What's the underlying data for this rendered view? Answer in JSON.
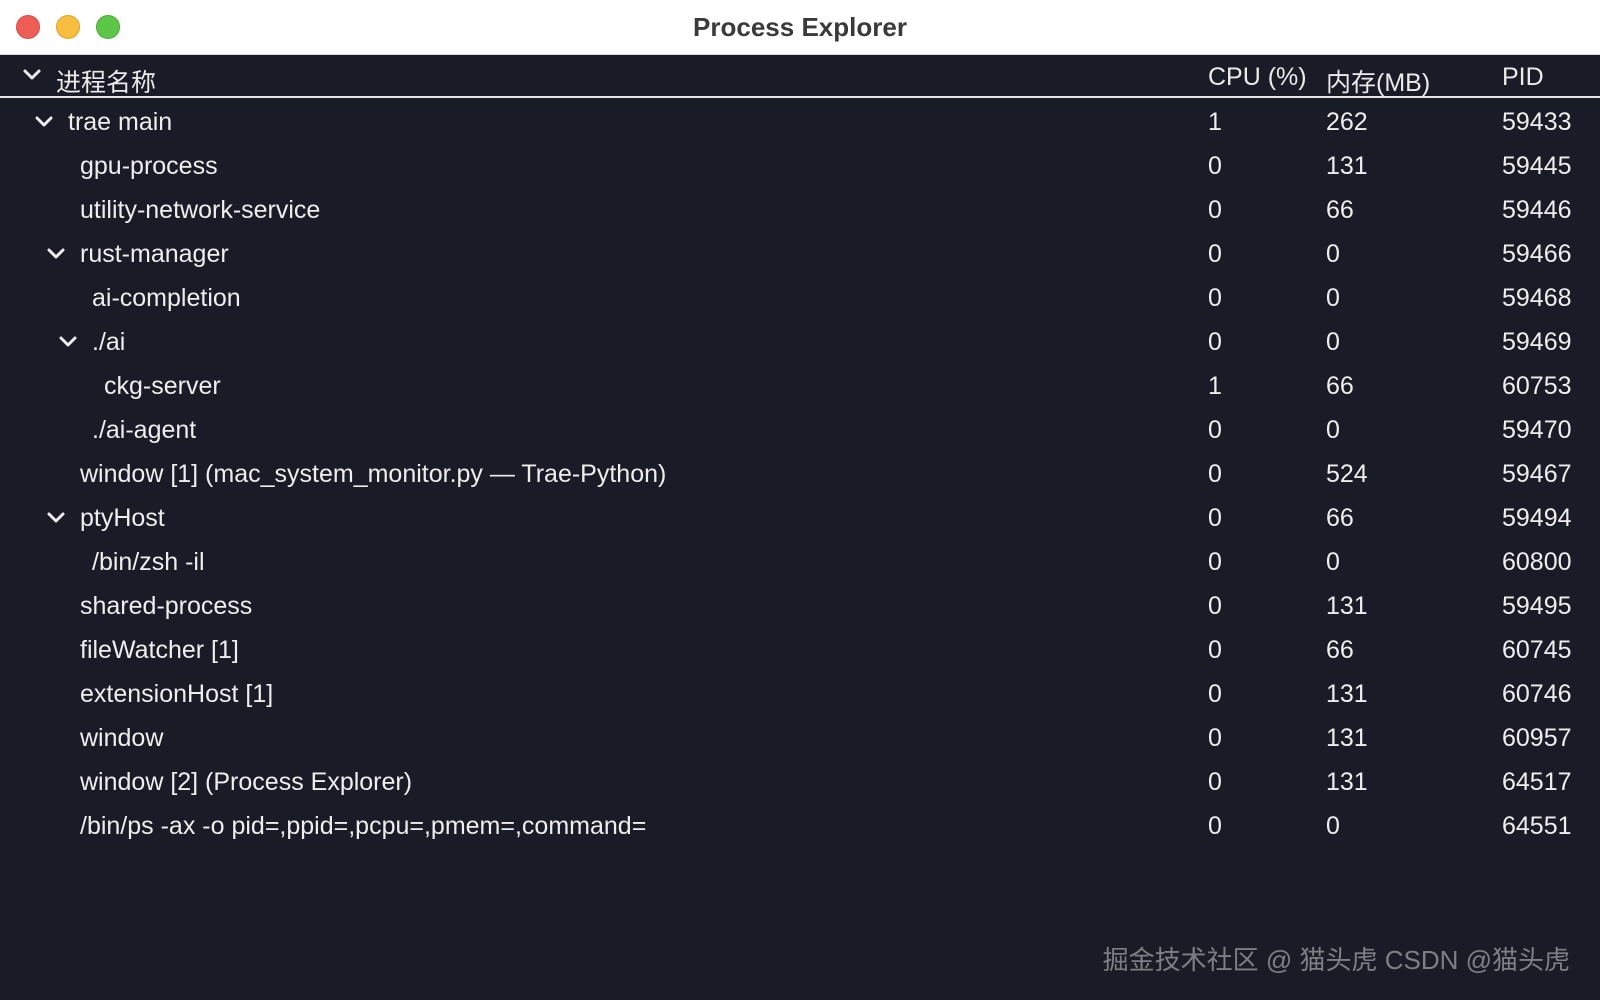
{
  "window": {
    "title": "Process Explorer"
  },
  "header": {
    "name": "进程名称",
    "cpu": "CPU (%)",
    "mem": "内存(MB)",
    "pid": "PID"
  },
  "rows": [
    {
      "name": "trae main",
      "cpu": "1",
      "mem": "262",
      "pid": "59433",
      "level": 0,
      "expanded": true
    },
    {
      "name": "gpu-process",
      "cpu": "0",
      "mem": "131",
      "pid": "59445",
      "level": 1,
      "expanded": false
    },
    {
      "name": "utility-network-service",
      "cpu": "0",
      "mem": "66",
      "pid": "59446",
      "level": 1,
      "expanded": false
    },
    {
      "name": "rust-manager",
      "cpu": "0",
      "mem": "0",
      "pid": "59466",
      "level": 1,
      "expanded": true
    },
    {
      "name": "ai-completion",
      "cpu": "0",
      "mem": "0",
      "pid": "59468",
      "level": 2,
      "expanded": false
    },
    {
      "name": "./ai",
      "cpu": "0",
      "mem": "0",
      "pid": "59469",
      "level": 2,
      "expanded": true
    },
    {
      "name": "ckg-server",
      "cpu": "1",
      "mem": "66",
      "pid": "60753",
      "level": 3,
      "expanded": false
    },
    {
      "name": "./ai-agent",
      "cpu": "0",
      "mem": "0",
      "pid": "59470",
      "level": 2,
      "expanded": false
    },
    {
      "name": "window [1] (mac_system_monitor.py — Trae-Python)",
      "cpu": "0",
      "mem": "524",
      "pid": "59467",
      "level": 1,
      "expanded": false
    },
    {
      "name": "ptyHost",
      "cpu": "0",
      "mem": "66",
      "pid": "59494",
      "level": 1,
      "expanded": true
    },
    {
      "name": "/bin/zsh -il",
      "cpu": "0",
      "mem": "0",
      "pid": "60800",
      "level": 2,
      "expanded": false
    },
    {
      "name": "shared-process",
      "cpu": "0",
      "mem": "131",
      "pid": "59495",
      "level": 1,
      "expanded": false
    },
    {
      "name": "fileWatcher [1]",
      "cpu": "0",
      "mem": "66",
      "pid": "60745",
      "level": 1,
      "expanded": false
    },
    {
      "name": "extensionHost [1]",
      "cpu": "0",
      "mem": "131",
      "pid": "60746",
      "level": 1,
      "expanded": false
    },
    {
      "name": "window",
      "cpu": "0",
      "mem": "131",
      "pid": "60957",
      "level": 1,
      "expanded": false
    },
    {
      "name": "window [2] (Process Explorer)",
      "cpu": "0",
      "mem": "131",
      "pid": "64517",
      "level": 1,
      "expanded": false
    },
    {
      "name": "/bin/ps -ax -o pid=,ppid=,pcpu=,pmem=,command=",
      "cpu": "0",
      "mem": "0",
      "pid": "64551",
      "level": 1,
      "expanded": false
    }
  ],
  "watermark": "掘金技术社区 @ 猫头虎 CSDN @猫头虎"
}
